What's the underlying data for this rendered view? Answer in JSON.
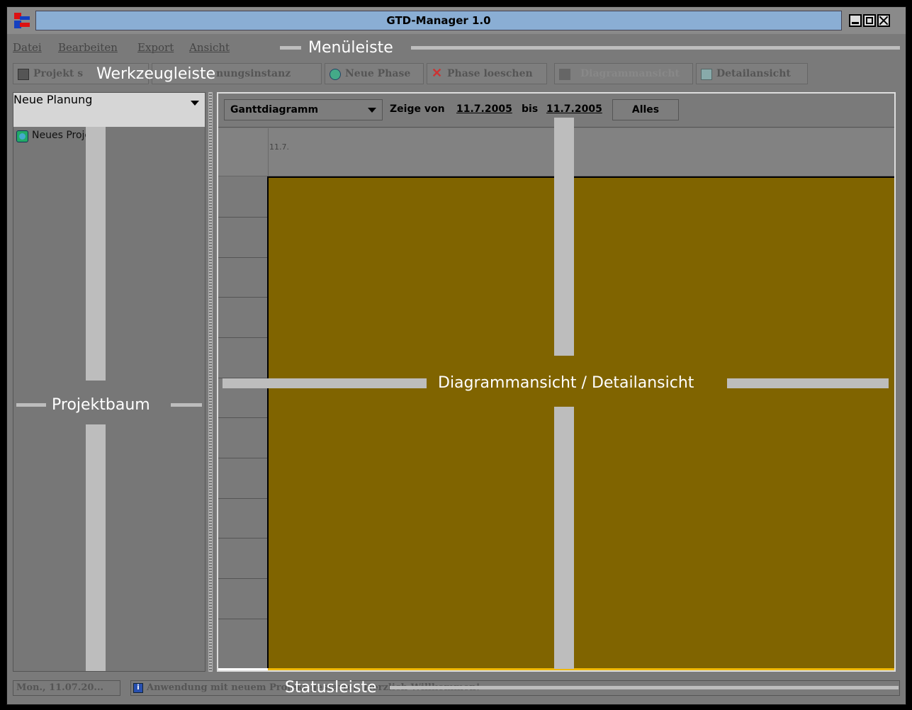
{
  "window": {
    "title": "GTD-Manager 1.0"
  },
  "menubar": {
    "items": [
      "Datei",
      "Bearbeiten",
      "Export",
      "Ansicht"
    ],
    "overlay_label": "Menüleiste"
  },
  "toolbar": {
    "overlay_label": "Werkzeugleiste",
    "buttons": [
      {
        "label": "Projekt speichern",
        "visible_text": "Projekt s",
        "icon": "save-icon"
      },
      {
        "label": "Neue Planungsinstanz",
        "visible_text": "nungsinstanz",
        "icon": "planning-icon"
      },
      {
        "label": "Neue Phase",
        "icon": "new-phase-icon"
      },
      {
        "label": "Phase loeschen",
        "icon": "delete-x-icon"
      },
      {
        "label": "Diagrammansicht",
        "icon": "diagram-icon"
      },
      {
        "label": "Detailansicht",
        "icon": "detail-icon"
      }
    ]
  },
  "left_panel": {
    "planning_select": "Neue Planung",
    "tree_items": [
      {
        "label": "Neues Projekt",
        "icon": "project-icon"
      }
    ],
    "overlay_label": "Projektbaum"
  },
  "right_panel": {
    "view_select": "Ganttdiagramm",
    "range_prefix": "Zeige von",
    "from_date": "11.7.2005",
    "range_middle": "bis",
    "to_date": "11.7.2005",
    "all_button": "Alles",
    "date_header_label": "11.7.",
    "overlay_label": "Diagrammansicht / Detailansicht",
    "bar_color": "#806400"
  },
  "statusbar": {
    "date": "Mon., 11.07.20...",
    "message": "Anwendung mit neuem Projekt gestartet. Herzlich Willkommen!",
    "overlay_label": "Statusleiste"
  }
}
